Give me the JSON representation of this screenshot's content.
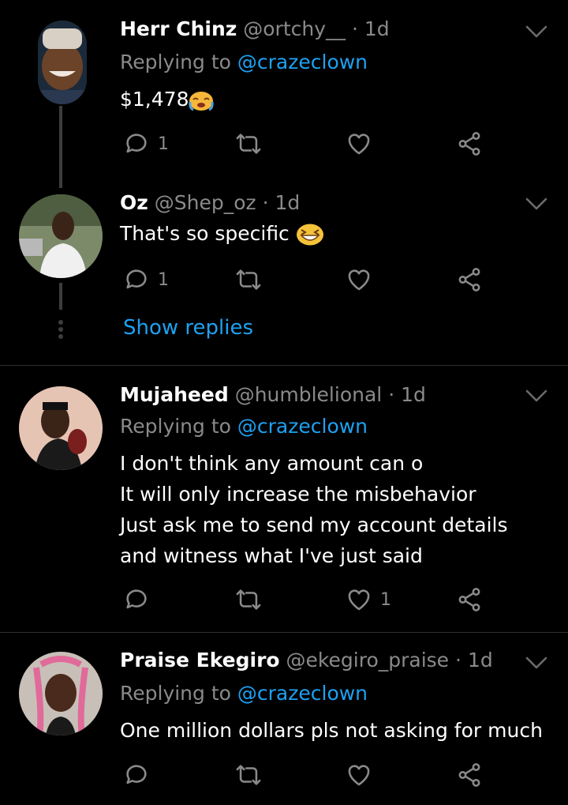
{
  "tweets": [
    {
      "name": "Herr Chinz",
      "handle": "@ortchy__",
      "time": "· 1d",
      "replying_prefix": "Replying to",
      "replying_handle": "@crazeclown",
      "text_lines": [
        "$1,478"
      ],
      "emoji": "loudly-crying-face",
      "reply_count": "1",
      "retweet_count": "",
      "like_count": ""
    },
    {
      "name": "Oz",
      "handle": "@Shep_oz",
      "time": "· 1d",
      "text_lines": [
        "That's so specific"
      ],
      "emoji": "grinning-squinting-face",
      "reply_count": "1",
      "retweet_count": "",
      "like_count": ""
    },
    {
      "name": "Mujaheed",
      "handle": "@humblelional",
      "time": "· 1d",
      "replying_prefix": "Replying to",
      "replying_handle": "@crazeclown",
      "text_lines": [
        "I don't think any amount can o",
        "It will only increase the misbehavior",
        "Just ask me to send my account details",
        "and witness what I've just said"
      ],
      "reply_count": "",
      "retweet_count": "",
      "like_count": "1"
    },
    {
      "name": "Praise Ekegiro",
      "handle": "@ekegiro_praise",
      "time": "· 1d",
      "replying_prefix": "Replying to",
      "replying_handle": "@crazeclown",
      "text_lines": [
        "One million dollars pls not asking for much"
      ],
      "reply_count": "",
      "retweet_count": "",
      "like_count": ""
    }
  ],
  "show_replies": "Show replies",
  "colors": {
    "background": "#000000",
    "secondary_text": "#8a8a8a",
    "link": "#1da1f2",
    "divider": "#2f2f2f"
  }
}
